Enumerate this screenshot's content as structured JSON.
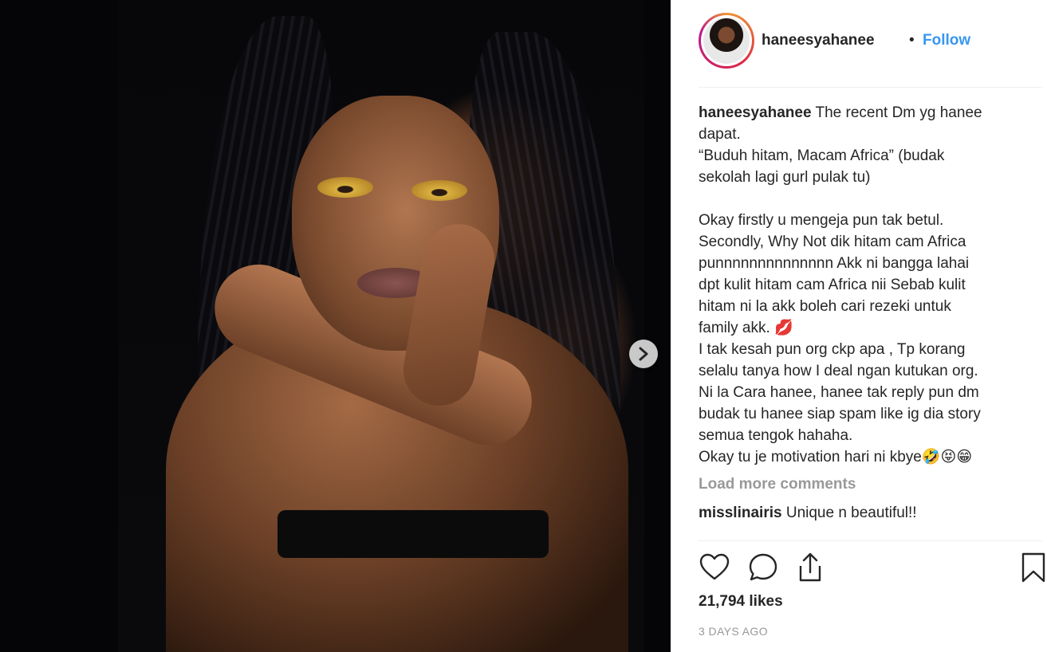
{
  "post": {
    "author": "haneesyahanee",
    "separator": "•",
    "follow_label": "Follow",
    "caption_user": "haneesyahanee",
    "caption_text": " The recent Dm yg hanee\ndapat.\n“Buduh hitam, Macam Africa” (budak\nsekolah lagi gurl pulak tu)\n\nOkay firstly u mengeja pun tak betul.\nSecondly, Why Not dik hitam cam Africa\npunnnnnnnnnnnnnn Akk ni bangga lahai\ndpt kulit hitam cam Africa nii Sebab kulit\nhitam ni la akk boleh cari rezeki untuk\nfamily akk. 💋\nI tak kesah pun org ckp apa , Tp korang\nselalu tanya how I deal ngan kutukan org.\nNi la Cara hanee, hanee tak reply pun dm\nbudak tu hanee siap spam like ig dia story\nsemua tengok hahaha.\nOkay tu je motivation hari ni kbye🤣😝😁",
    "load_more_label": "Load more comments",
    "comments": [
      {
        "user": "misslinairis",
        "text": " Unique n beautiful!!"
      }
    ],
    "likes": "21,794 likes",
    "timestamp": "3 DAYS AGO"
  },
  "icons": {
    "next": "chevron-right-icon",
    "like": "heart-icon",
    "comment": "comment-bubble-icon",
    "share": "share-icon",
    "save": "bookmark-icon"
  },
  "colors": {
    "link": "#3897f0",
    "muted": "#999999",
    "text": "#262626"
  }
}
